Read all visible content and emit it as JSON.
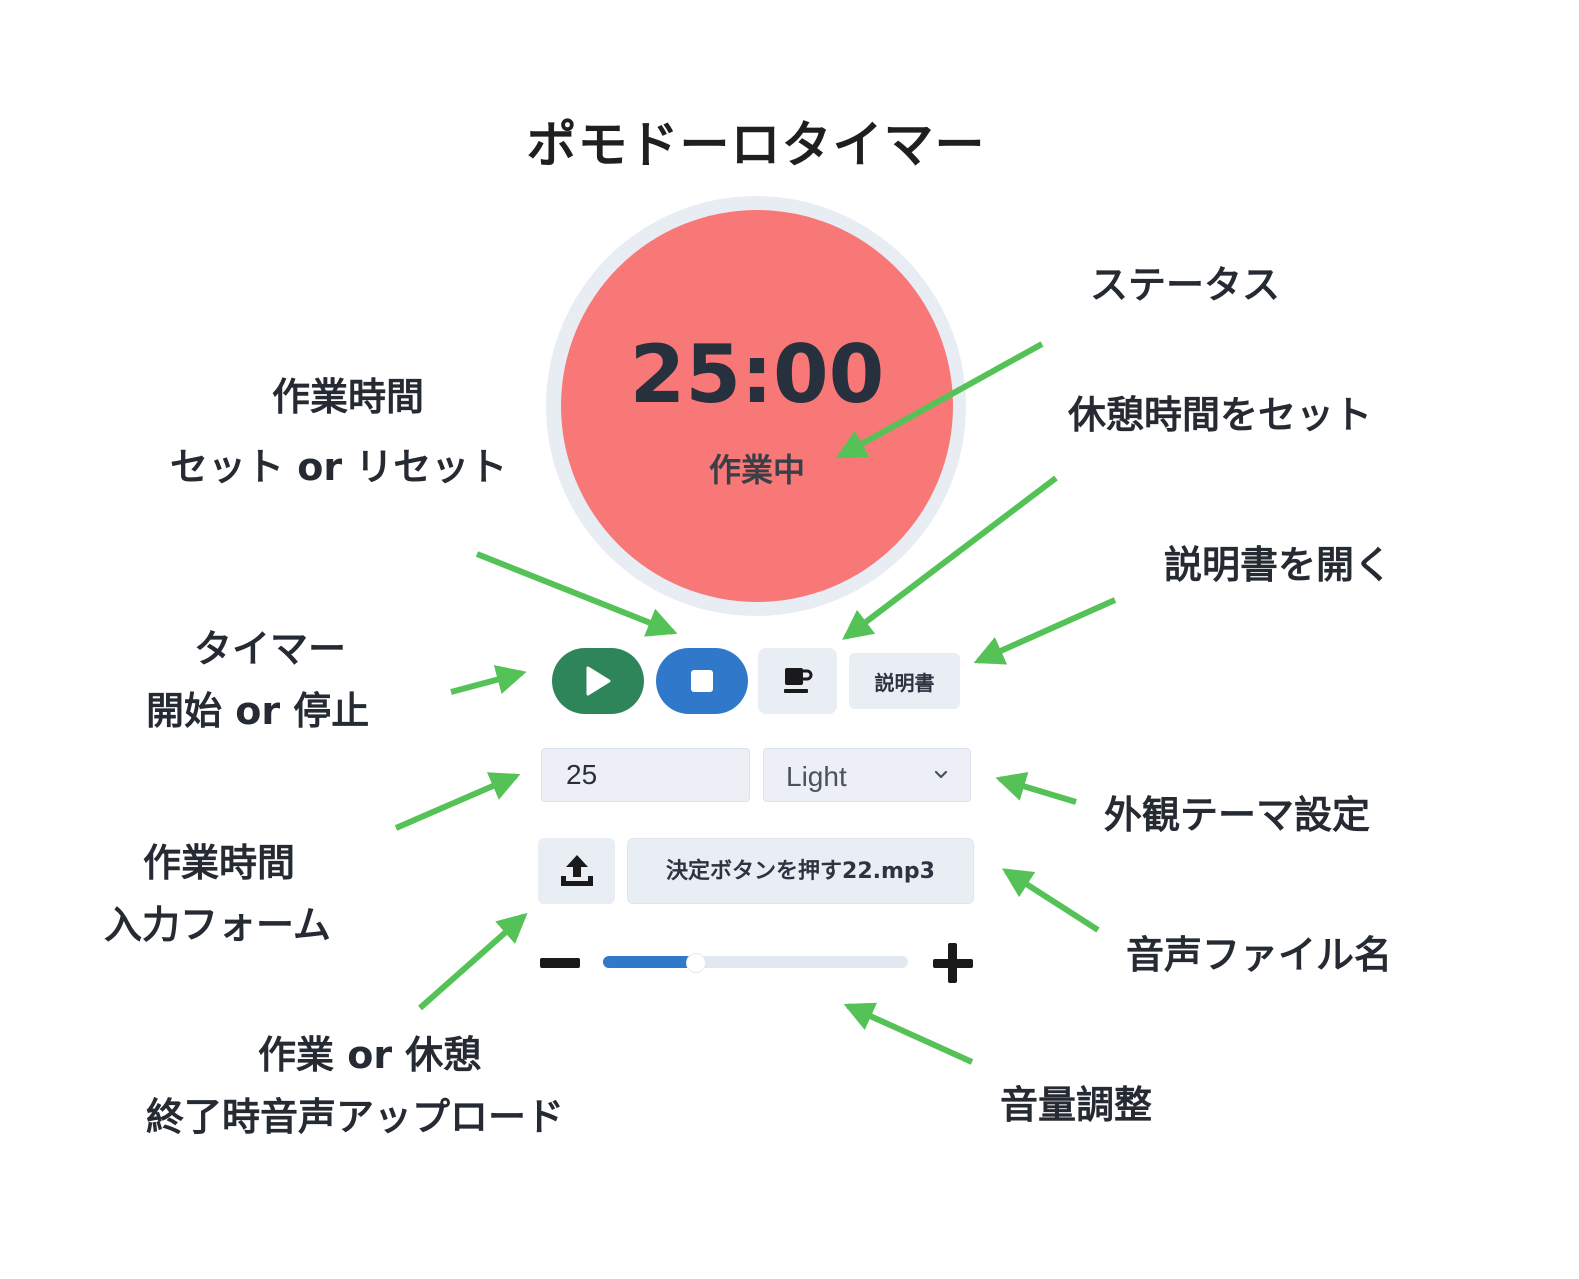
{
  "app": {
    "title": "ポモドーロタイマー"
  },
  "timer": {
    "time": "25:00",
    "status": "作業中"
  },
  "controls": {
    "play_icon": "play-icon",
    "stop_icon": "stop-icon",
    "break_icon": "coffee-cup-icon",
    "manual_label": "説明書"
  },
  "settings": {
    "work_minutes": "25",
    "theme": "Light",
    "upload_icon": "upload-icon",
    "file_name": "決定ボタンを押す22.mp3",
    "volume": 0.3
  },
  "annotations": {
    "status": "ステータス",
    "work_time_line1": "作業時間",
    "work_time_line2": "セット or リセット",
    "break_set": "休憩時間をセット",
    "manual_open": "説明書を開く",
    "timer_line1": "タイマー",
    "timer_line2": "開始 or 停止",
    "theme_setting": "外観テーマ設定",
    "work_input_line1": "作業時間",
    "work_input_line2": "入力フォーム",
    "file_name": "音声ファイル名",
    "upload_line1": "作業 or 休憩",
    "upload_line2": "終了時音声アップロード",
    "volume": "音量調整"
  },
  "colors": {
    "work_face": "#f87777",
    "play_button": "#2f855a",
    "stop_button": "#3078c9",
    "arrow": "#55c257",
    "volume_fill": "#3078c9"
  }
}
